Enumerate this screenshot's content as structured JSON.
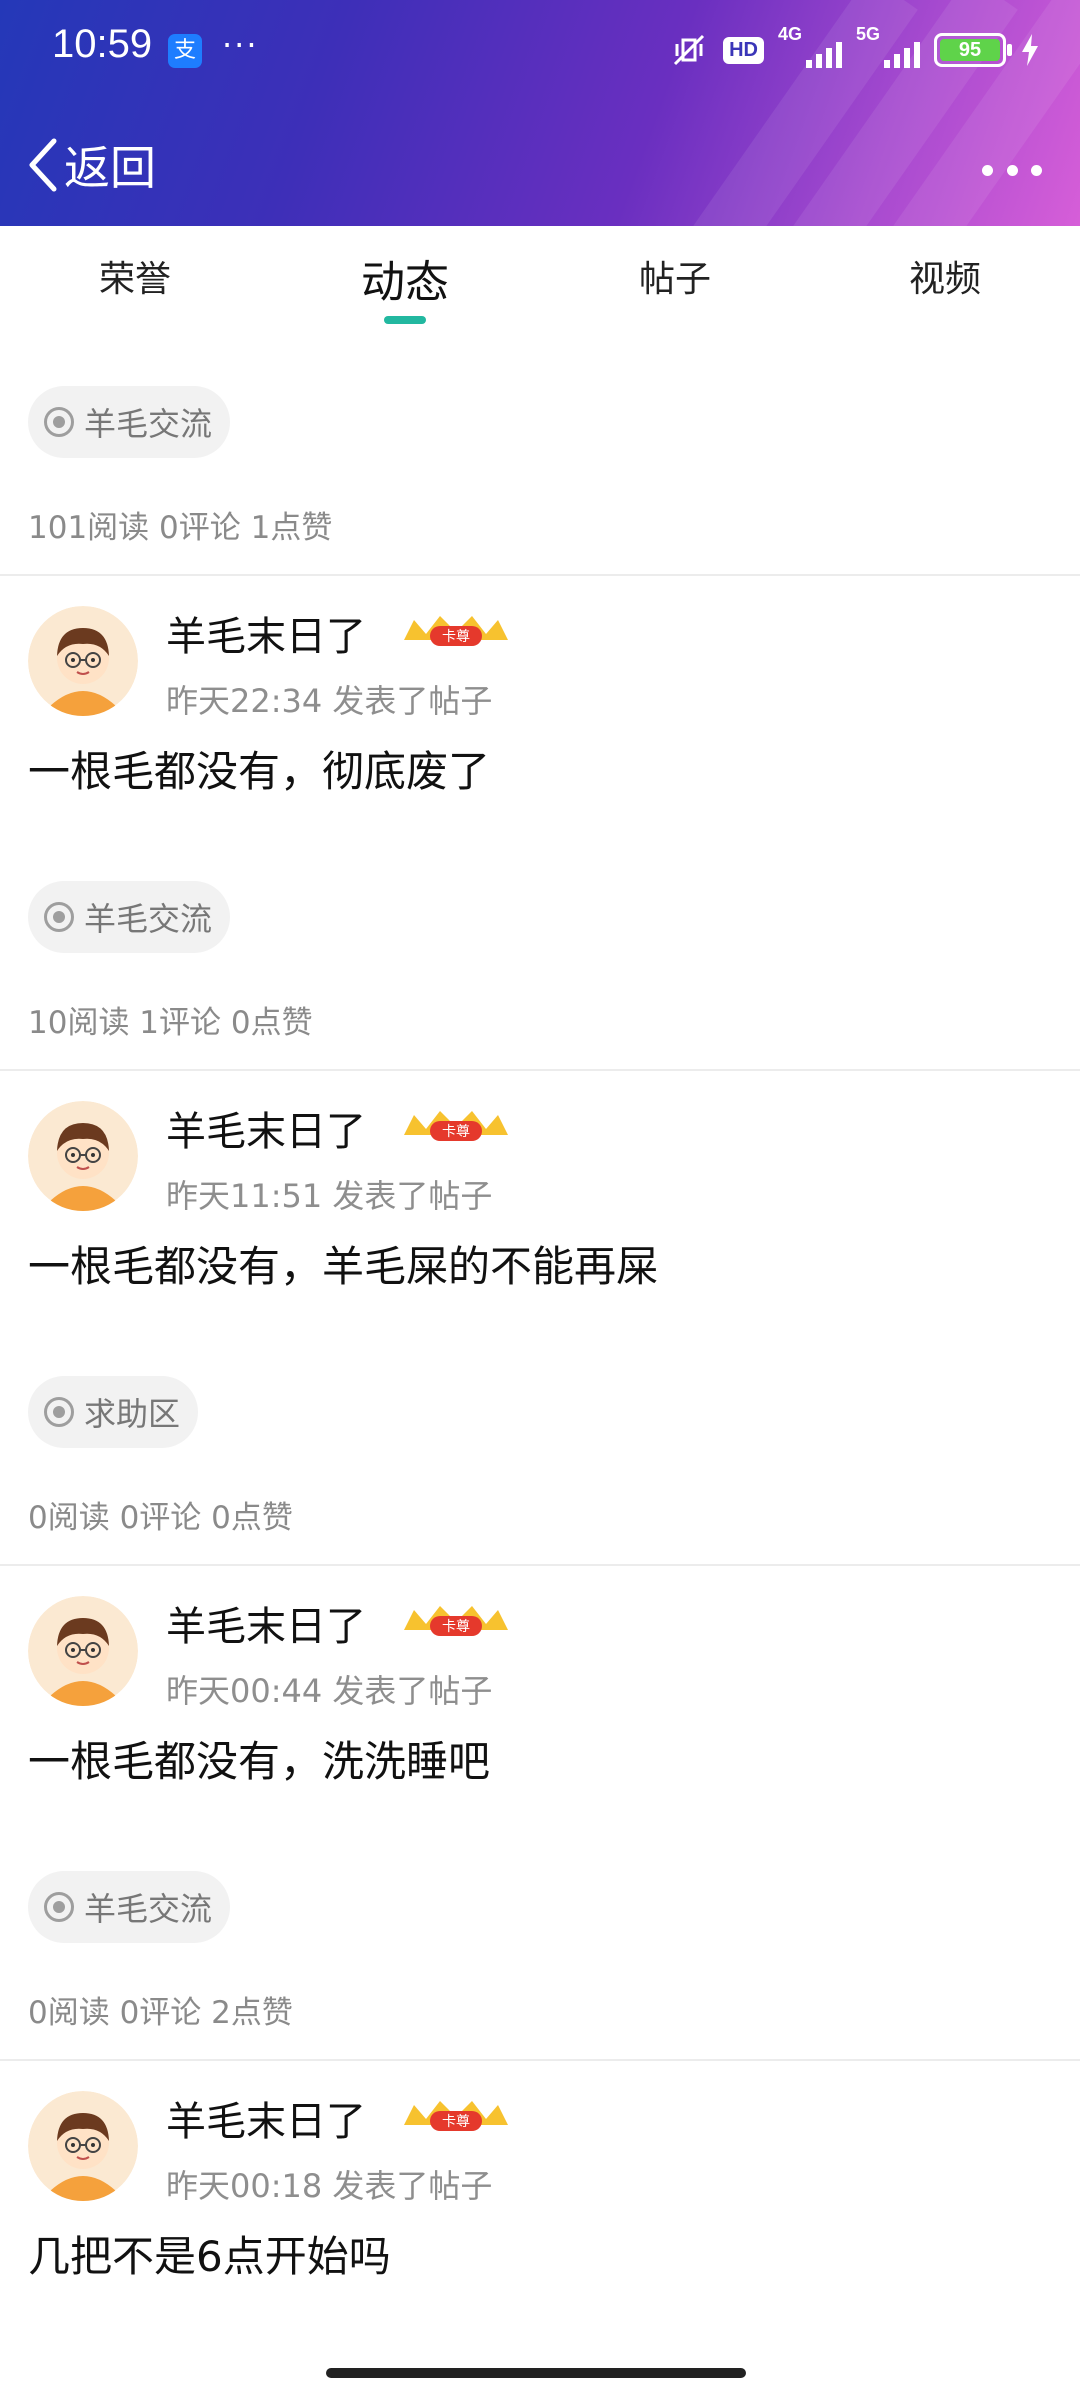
{
  "statusbar": {
    "time": "10:59",
    "alipay_glyph": "支",
    "more_dots": "···",
    "hd_label": "HD",
    "net1_label": "4G",
    "net2_label": "5G",
    "battery": "95"
  },
  "navbar": {
    "back_label": "返回"
  },
  "tabs": [
    {
      "label": "荣誉",
      "active": false
    },
    {
      "label": "动态",
      "active": true
    },
    {
      "label": "帖子",
      "active": false
    },
    {
      "label": "视频",
      "active": false
    }
  ],
  "feed": [
    {
      "tag": "羊毛交流",
      "stats": "101阅读 0评论 1点赞",
      "author": "羊毛末日了",
      "vip_badge": "卡尊",
      "meta": "昨天22:34 发表了帖子",
      "content": "一根毛都没有，彻底废了"
    },
    {
      "tag": "羊毛交流",
      "stats": "10阅读 1评论 0点赞",
      "author": "羊毛末日了",
      "vip_badge": "卡尊",
      "meta": "昨天11:51 发表了帖子",
      "content": "一根毛都没有，羊毛屎的不能再屎"
    },
    {
      "tag": "求助区",
      "stats": "0阅读 0评论 0点赞",
      "author": "羊毛末日了",
      "vip_badge": "卡尊",
      "meta": "昨天00:44 发表了帖子",
      "content": "一根毛都没有，洗洗睡吧"
    },
    {
      "tag": "羊毛交流",
      "stats": "0阅读 0评论 2点赞",
      "author": "羊毛末日了",
      "vip_badge": "卡尊",
      "meta": "昨天00:18 发表了帖子",
      "content": "几把不是6点开始吗"
    }
  ],
  "colors": {
    "accent": "#22b8a0",
    "header_start": "#2438b8",
    "header_end": "#d65ed8"
  }
}
